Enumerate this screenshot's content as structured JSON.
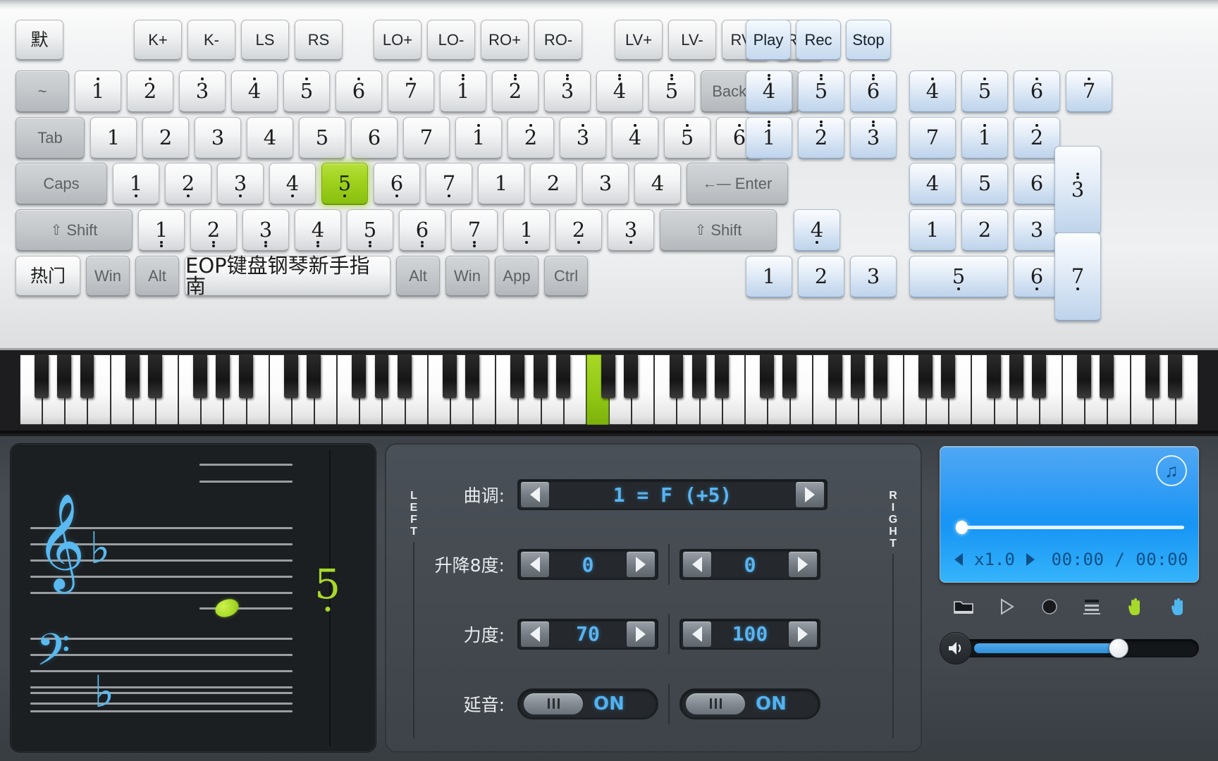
{
  "app": {
    "spacebar_label": "EOP键盘钢琴新手指南",
    "preset_label": "默",
    "hot_label": "热门"
  },
  "macro_buttons": [
    {
      "label": "K+"
    },
    {
      "label": "K-"
    },
    {
      "label": "LS"
    },
    {
      "label": "RS"
    },
    {
      "label": "LO+"
    },
    {
      "label": "LO-"
    },
    {
      "label": "RO+"
    },
    {
      "label": "RO-"
    },
    {
      "label": "LV+"
    },
    {
      "label": "LV-"
    },
    {
      "label": "RV+"
    },
    {
      "label": "RV-"
    }
  ],
  "transport": [
    {
      "label": "Play",
      "name": "play-button"
    },
    {
      "label": "Rec",
      "name": "rec-button"
    },
    {
      "label": "Stop",
      "name": "stop-button"
    }
  ],
  "keyboard_rows": {
    "row_number": [
      {
        "label": "~",
        "type": "grey"
      },
      {
        "num": "1",
        "dots": 1,
        "dir": "up"
      },
      {
        "num": "2",
        "dots": 1,
        "dir": "up"
      },
      {
        "num": "3",
        "dots": 1,
        "dir": "up"
      },
      {
        "num": "4",
        "dots": 1,
        "dir": "up"
      },
      {
        "num": "5",
        "dots": 1,
        "dir": "up"
      },
      {
        "num": "6",
        "dots": 1,
        "dir": "up"
      },
      {
        "num": "7",
        "dots": 1,
        "dir": "up"
      },
      {
        "num": "1",
        "dots": 2,
        "dir": "up"
      },
      {
        "num": "2",
        "dots": 2,
        "dir": "up"
      },
      {
        "num": "3",
        "dots": 2,
        "dir": "up"
      },
      {
        "num": "4",
        "dots": 2,
        "dir": "up"
      },
      {
        "num": "5",
        "dots": 2,
        "dir": "up"
      },
      {
        "label": "Backspace",
        "type": "grey"
      }
    ],
    "row_tab": [
      {
        "label": "Tab",
        "type": "grey"
      },
      {
        "num": "1",
        "dots": 0
      },
      {
        "num": "2",
        "dots": 0
      },
      {
        "num": "3",
        "dots": 0
      },
      {
        "num": "4",
        "dots": 0
      },
      {
        "num": "5",
        "dots": 0
      },
      {
        "num": "6",
        "dots": 0
      },
      {
        "num": "7",
        "dots": 0
      },
      {
        "num": "1",
        "dots": 1,
        "dir": "up"
      },
      {
        "num": "2",
        "dots": 1,
        "dir": "up"
      },
      {
        "num": "3",
        "dots": 1,
        "dir": "up"
      },
      {
        "num": "4",
        "dots": 1,
        "dir": "up"
      },
      {
        "num": "5",
        "dots": 1,
        "dir": "up"
      },
      {
        "num": "6",
        "dots": 1,
        "dir": "up"
      }
    ],
    "row_caps": [
      {
        "label": "Caps",
        "type": "grey"
      },
      {
        "num": "1",
        "dots": 1,
        "dir": "dn"
      },
      {
        "num": "2",
        "dots": 1,
        "dir": "dn"
      },
      {
        "num": "3",
        "dots": 1,
        "dir": "dn"
      },
      {
        "num": "4",
        "dots": 1,
        "dir": "dn"
      },
      {
        "num": "5",
        "dots": 1,
        "dir": "dn",
        "active": true
      },
      {
        "num": "6",
        "dots": 1,
        "dir": "dn"
      },
      {
        "num": "7",
        "dots": 1,
        "dir": "dn"
      },
      {
        "num": "1",
        "dots": 0
      },
      {
        "num": "2",
        "dots": 0
      },
      {
        "num": "3",
        "dots": 0
      },
      {
        "num": "4",
        "dots": 0
      },
      {
        "label": "Enter",
        "type": "grey",
        "icon": "enter-arrow"
      }
    ],
    "row_shift": [
      {
        "label": "Shift",
        "type": "grey",
        "icon": "shift-arrow"
      },
      {
        "num": "1",
        "dots": 2,
        "dir": "dn"
      },
      {
        "num": "2",
        "dots": 2,
        "dir": "dn"
      },
      {
        "num": "3",
        "dots": 2,
        "dir": "dn"
      },
      {
        "num": "4",
        "dots": 2,
        "dir": "dn"
      },
      {
        "num": "5",
        "dots": 2,
        "dir": "dn"
      },
      {
        "num": "6",
        "dots": 2,
        "dir": "dn"
      },
      {
        "num": "7",
        "dots": 2,
        "dir": "dn"
      },
      {
        "num": "1",
        "dots": 1,
        "dir": "dn"
      },
      {
        "num": "2",
        "dots": 1,
        "dir": "dn"
      },
      {
        "num": "3",
        "dots": 1,
        "dir": "dn"
      },
      {
        "label": "Shift",
        "type": "grey",
        "icon": "shift-arrow"
      }
    ],
    "row_space": [
      {
        "label": "热门",
        "type": "cjk"
      },
      {
        "label": "Win",
        "type": "grey"
      },
      {
        "label": "Alt",
        "type": "grey"
      },
      {
        "label": "EOP键盘钢琴新手指南",
        "type": "space"
      },
      {
        "label": "Alt",
        "type": "grey"
      },
      {
        "label": "Win",
        "type": "grey"
      },
      {
        "label": "App",
        "type": "grey"
      },
      {
        "label": "Ctrl",
        "type": "grey"
      }
    ]
  },
  "numpad_mid": {
    "row1": [
      {
        "num": "4",
        "dots": 2,
        "dir": "up"
      },
      {
        "num": "5",
        "dots": 2,
        "dir": "up"
      },
      {
        "num": "6",
        "dots": 2,
        "dir": "up"
      }
    ],
    "row2": [
      {
        "num": "1",
        "dots": 2,
        "dir": "up"
      },
      {
        "num": "2",
        "dots": 2,
        "dir": "up"
      },
      {
        "num": "3",
        "dots": 2,
        "dir": "up"
      }
    ],
    "row3": [
      {
        "num": "4",
        "dots": 1,
        "dir": "dn"
      }
    ],
    "row4": [
      {
        "num": "1",
        "dots": 0
      },
      {
        "num": "2",
        "dots": 0
      },
      {
        "num": "3",
        "dots": 0
      }
    ]
  },
  "numpad_right": {
    "row1": [
      {
        "num": "4",
        "dots": 1,
        "dir": "up"
      },
      {
        "num": "5",
        "dots": 1,
        "dir": "up"
      },
      {
        "num": "6",
        "dots": 1,
        "dir": "up"
      },
      {
        "num": "7",
        "dots": 1,
        "dir": "up"
      }
    ],
    "row2": [
      {
        "num": "7",
        "dots": 0
      },
      {
        "num": "1",
        "dots": 1,
        "dir": "up"
      },
      {
        "num": "2",
        "dots": 1,
        "dir": "up"
      }
    ],
    "row3": [
      {
        "num": "4",
        "dots": 0
      },
      {
        "num": "5",
        "dots": 0
      },
      {
        "num": "6",
        "dots": 0
      }
    ],
    "row4": [
      {
        "num": "1",
        "dots": 0
      },
      {
        "num": "2",
        "dots": 0
      },
      {
        "num": "3",
        "dots": 0
      }
    ],
    "row5": [
      {
        "num": "5",
        "dots": 1,
        "dir": "dn"
      },
      {
        "num": "6",
        "dots": 1,
        "dir": "dn"
      }
    ],
    "tall_top": {
      "num": "3",
      "dots": 2,
      "dir": "up"
    },
    "tall_bottom": {
      "num": "7",
      "dots": 1,
      "dir": "dn"
    }
  },
  "piano": {
    "white_key_count": 52,
    "active_white_index": 25
  },
  "score": {
    "big_number": "5",
    "big_number_dots": 1,
    "big_number_dot_dir": "dn",
    "treble_clef": "𝄞",
    "bass_clef": "𝄢",
    "accidental": "♭"
  },
  "controls": {
    "left_label": "LEFT",
    "right_label": "RIGHT",
    "rows": [
      {
        "label": "曲调:",
        "name": "key-signature",
        "value": "1 = F (+5)",
        "kind": "wide"
      },
      {
        "label": "升降8度:",
        "name": "octave-shift",
        "left_value": "0",
        "right_value": "0",
        "kind": "pair"
      },
      {
        "label": "力度:",
        "name": "velocity",
        "left_value": "70",
        "right_value": "100",
        "kind": "pair"
      },
      {
        "label": "延音:",
        "name": "sustain",
        "left_value": "ON",
        "right_value": "ON",
        "kind": "toggle"
      }
    ]
  },
  "player": {
    "speed": "x1.0",
    "time": "00:00 / 00:00",
    "seek_percent": 2,
    "volume_percent": 66,
    "tools": [
      {
        "name": "open-folder-icon",
        "label": "folder"
      },
      {
        "name": "play-icon",
        "label": "play"
      },
      {
        "name": "record-icon",
        "label": "record"
      },
      {
        "name": "score-view-icon",
        "label": "score"
      },
      {
        "name": "left-hand-icon",
        "label": "left-hand",
        "color": "#a6d92a"
      },
      {
        "name": "right-hand-icon",
        "label": "right-hand",
        "color": "#4fb6ef"
      }
    ]
  },
  "colors": {
    "active_key": "#9fd11d",
    "lcd_blue": "#1f93f3",
    "value_blue": "#5ab4f0",
    "hand_green": "#a6d92a",
    "hand_blue": "#4fb6ef"
  }
}
